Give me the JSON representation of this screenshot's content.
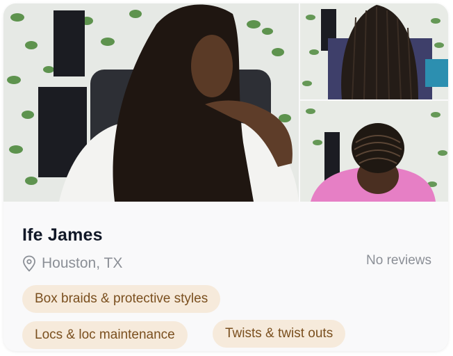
{
  "stylist": {
    "name": "Ife James",
    "location": "Houston, TX",
    "reviews": "No reviews"
  },
  "tags": [
    "Box braids & protective styles",
    "Locs & loc maintenance",
    "Twists & twist outs"
  ],
  "photos": [
    {
      "icon": "photo-long-curly-braids"
    },
    {
      "icon": "photo-knotless-braids-back"
    },
    {
      "icon": "photo-cornrows-top"
    }
  ],
  "colors": {
    "tag_background": "#f6eadb",
    "tag_text": "#7a4f1e",
    "name_text": "#111827",
    "muted_text": "#8b8f96"
  }
}
